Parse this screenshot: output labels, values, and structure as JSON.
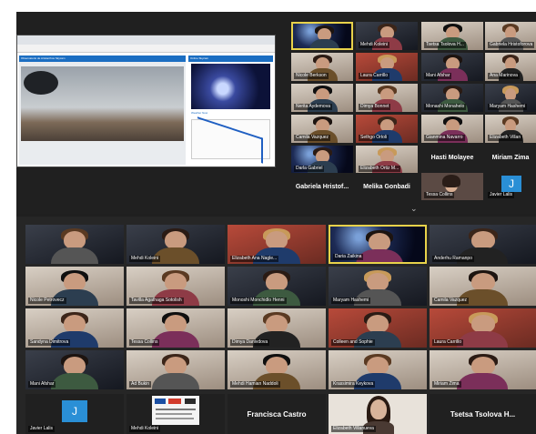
{
  "screenshare": {
    "left_panel_title": "Observatorio de Aristarchos Skycam",
    "right_panel_title": "Online Skycam",
    "right_panel_subtitle": "Weather Now"
  },
  "top_grid": [
    {
      "name": "",
      "scene": "space",
      "active": true
    },
    {
      "name": "Mehdi Koleini",
      "scene": "dark"
    },
    {
      "name": "Tsetsa Tsolova H...",
      "scene": "home"
    },
    {
      "name": "Gabriela Hristoforova",
      "scene": "home"
    },
    {
      "name": "Nicole Berkson",
      "scene": "home"
    },
    {
      "name": "Laura Carrillo",
      "scene": "red"
    },
    {
      "name": "Mani Afshar",
      "scene": "dark"
    },
    {
      "name": "Ana Marinova",
      "scene": "home"
    },
    {
      "name": "Nerita Aydemova",
      "scene": "home"
    },
    {
      "name": "Dimya Bonnet",
      "scene": "home"
    },
    {
      "name": "Monashi Monahelo",
      "scene": "dark"
    },
    {
      "name": "Maryam Hashemi",
      "scene": "dark"
    },
    {
      "name": "Camila Vazquez",
      "scene": "home"
    },
    {
      "name": "Sethgo Ortoli",
      "scene": "red"
    },
    {
      "name": "Gianmina Navarro",
      "scene": "home"
    },
    {
      "name": "Elizabeth Villan",
      "scene": "home"
    },
    {
      "name": "Darla Gabriel",
      "scene": "space"
    },
    {
      "name": "Elizabeth Ortiz M...",
      "scene": "home"
    }
  ],
  "top_name_tiles": [
    "Hasti Molayee",
    "Miriam Zima",
    "Gabriela Hristof...",
    "Melika Gonbadi"
  ],
  "top_small": {
    "name": "Tessa Collins",
    "javier_letter": "J",
    "javier_name": "Javier Lalis"
  },
  "bottom_grid": [
    {
      "name": "",
      "scene": "dark"
    },
    {
      "name": "Mehdi Koleini",
      "scene": "dark"
    },
    {
      "name": "Elizabeth Ana Nagle...",
      "scene": "red"
    },
    {
      "name": "Daria Zaikina",
      "scene": "space",
      "active": true
    },
    {
      "name": "Anderhu Ramanpo",
      "scene": "dark"
    },
    {
      "name": "Nicole Petrovecz",
      "scene": "home"
    },
    {
      "name": "Tavilla Agathaga Sotolish",
      "scene": "home"
    },
    {
      "name": "Monoshi Monchidlo Henni",
      "scene": "dark"
    },
    {
      "name": "Maryam Hashemi",
      "scene": "dark"
    },
    {
      "name": "Camila Vazquez",
      "scene": "home"
    },
    {
      "name": "Sandyna Dimitrova",
      "scene": "home"
    },
    {
      "name": "Tessa Collins",
      "scene": "home"
    },
    {
      "name": "Dimya Danivdova",
      "scene": "home"
    },
    {
      "name": "Colleen and Sophie",
      "scene": "red"
    },
    {
      "name": "Laura Carrillo",
      "scene": "red"
    },
    {
      "name": "Mani Afshar",
      "scene": "dark"
    },
    {
      "name": "Ad Bukin",
      "scene": "home"
    },
    {
      "name": "Mehdi Hamian Naddoli",
      "scene": "home"
    },
    {
      "name": "Krassimira Keykova",
      "scene": "home"
    },
    {
      "name": "Miriam Zima",
      "scene": "home"
    }
  ],
  "bottom_last_row": {
    "javier_letter": "J",
    "javier_name": "Javier Lalis",
    "poster_name": "Mehdi Koleini",
    "francisca": "Francisca Castro",
    "elizabeth": "Elizabeth Villanueva",
    "tsetsa": "Tsetsa Tsolova H..."
  }
}
